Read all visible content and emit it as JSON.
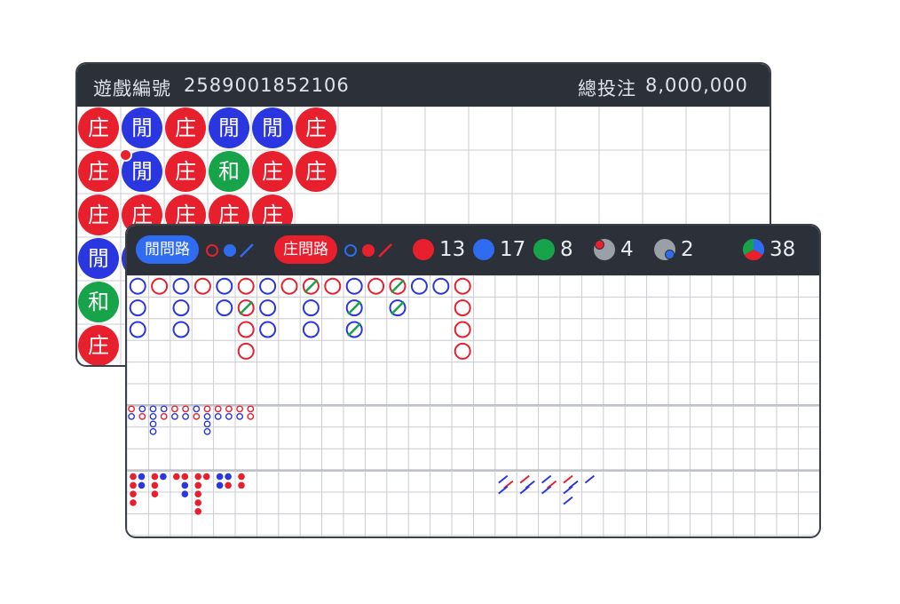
{
  "game": {
    "id_label": "遊戲編號",
    "id_value": "2589001852106",
    "total_bet_label": "總投注",
    "total_bet_value": "8,000,000"
  },
  "colors": {
    "banker": "#e8202e",
    "player": "#2a36e0",
    "tie": "#16a34a",
    "header": "#2c3139"
  },
  "bead_road": {
    "glyphs": {
      "banker": "庄",
      "player": "閒",
      "tie": "和"
    },
    "columns": [
      [
        "banker",
        "banker",
        "banker",
        "player",
        "tie",
        "banker"
      ],
      [
        "player",
        "player",
        "banker",
        "player",
        "",
        ""
      ],
      [
        "banker",
        "banker",
        "banker",
        "",
        "",
        ""
      ],
      [
        "player",
        "tie",
        "banker",
        "",
        "",
        ""
      ],
      [
        "player",
        "banker",
        "banker",
        "",
        "",
        ""
      ],
      [
        "banker",
        "banker",
        "",
        "",
        "",
        ""
      ]
    ]
  },
  "ask_road": {
    "player_ask_label": "閒問路",
    "banker_ask_label": "庄問路"
  },
  "stats": {
    "banker_count": "13",
    "player_count": "17",
    "tie_count": "8",
    "banker_pair_count": "4",
    "player_pair_count": "2",
    "total_count": "38"
  },
  "big_road": {
    "columns": [
      [
        "P",
        "P",
        "P"
      ],
      [
        "B"
      ],
      [
        "P",
        "P",
        "P"
      ],
      [
        "B"
      ],
      [
        "P",
        "P"
      ],
      [
        "B",
        "B*",
        "B",
        "B"
      ],
      [
        "P",
        "P",
        "P"
      ],
      [
        "B"
      ],
      [
        "B*",
        "P",
        "P"
      ],
      [
        "B"
      ],
      [
        "P",
        "P*",
        "P*"
      ],
      [
        "B"
      ],
      [
        "B*",
        "P*"
      ],
      [
        "P"
      ],
      [
        "P"
      ],
      [
        "B",
        "B",
        "B",
        "B"
      ]
    ]
  },
  "big_eye_road": {
    "columns": [
      [
        "B",
        "P"
      ],
      [
        "P",
        "B"
      ],
      [
        "P",
        "P",
        "P",
        "P"
      ],
      [
        "P",
        "B"
      ],
      [
        "B",
        "P"
      ],
      [
        "B",
        "P"
      ],
      [
        "P",
        "B"
      ],
      [
        "B",
        "P",
        "P",
        "P"
      ],
      [
        "B",
        "P"
      ],
      [
        "B",
        "P"
      ],
      [
        "B",
        "P"
      ],
      [
        "B",
        "B"
      ]
    ]
  },
  "small_road": {
    "columns": [
      [
        "B",
        "B",
        "P",
        "P"
      ],
      [
        "B",
        "B",
        "B",
        "B"
      ],
      [
        "B",
        "P",
        "B",
        "B"
      ],
      [
        "P",
        "B",
        "B",
        "B"
      ],
      [
        "B",
        "B",
        "P",
        "P"
      ],
      [
        "B",
        "B",
        "B",
        "B"
      ]
    ],
    "col_shapes": [
      [
        4,
        2,
        1,
        0
      ],
      [
        4,
        1,
        0,
        0
      ],
      [
        2,
        2,
        0,
        0
      ],
      [
        3,
        2,
        0,
        0
      ],
      [
        2,
        2,
        0,
        0
      ],
      [
        2,
        1,
        0,
        0
      ]
    ]
  },
  "cockroach_road": {
    "columns": [
      [
        "B",
        "P",
        "P",
        "P"
      ],
      [
        "B",
        "P",
        "P",
        "P"
      ],
      [
        "B",
        "P",
        "P",
        "B"
      ],
      [
        "P",
        "P",
        "P"
      ],
      [
        "P"
      ],
      [
        "P"
      ]
    ]
  }
}
